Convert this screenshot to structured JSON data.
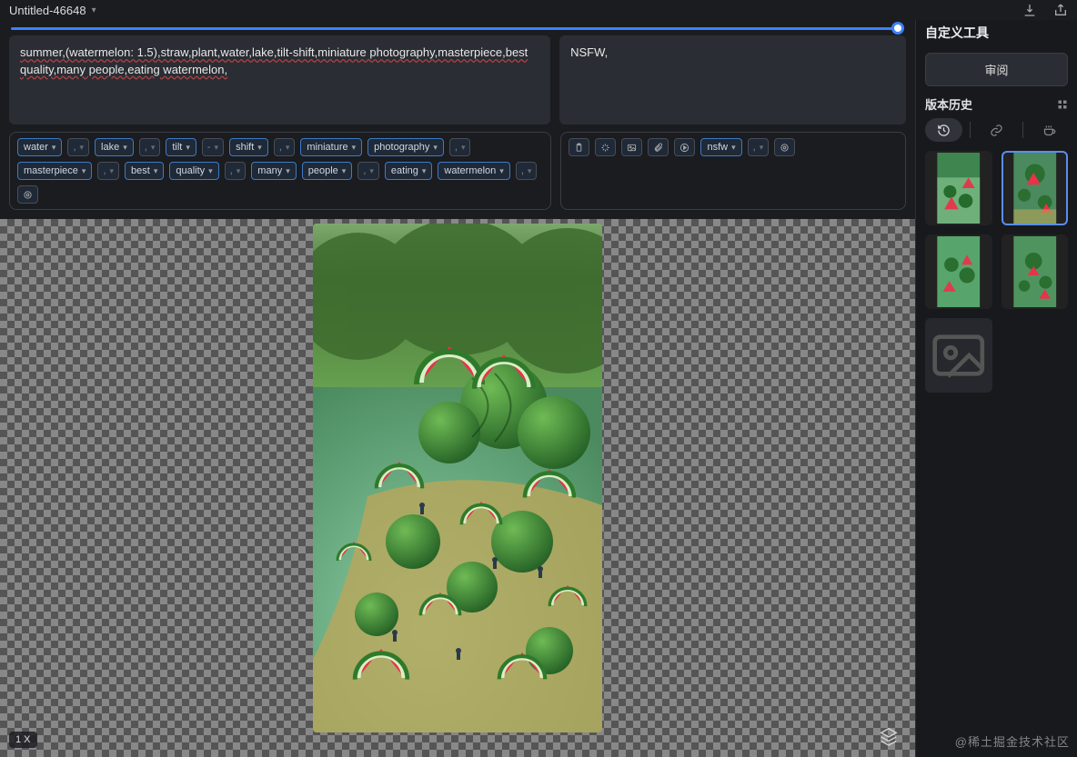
{
  "header": {
    "title": "Untitled-46648",
    "icons": [
      "download-icon",
      "share-icon"
    ]
  },
  "prompt": {
    "positive": "summer,(watermelon: 1.5),straw,plant,water,lake,tilt-shift,miniature photography,masterpiece,best quality,many people,eating watermelon,",
    "negative": "NSFW,"
  },
  "tags_positive_visible": [
    "water",
    ",",
    "lake",
    ",",
    "tilt",
    "-",
    "shift",
    ",",
    "miniature",
    "photography",
    ",",
    "masterpiece",
    ",",
    "best",
    "quality",
    ",",
    "many",
    "people",
    ",",
    "eating",
    "watermelon",
    ","
  ],
  "tags_positive_extra_icon": "target-icon",
  "tags_negative": [
    {
      "type": "icon",
      "name": "clipboard-icon"
    },
    {
      "type": "icon",
      "name": "sparkle-icon"
    },
    {
      "type": "icon",
      "name": "image-icon"
    },
    {
      "type": "icon",
      "name": "attach-icon"
    },
    {
      "type": "icon",
      "name": "play-icon"
    },
    {
      "type": "tag",
      "label": "nsfw"
    },
    {
      "type": "sep",
      "label": ","
    },
    {
      "type": "icon",
      "name": "target-icon"
    }
  ],
  "canvas": {
    "zoom": "1 X"
  },
  "right": {
    "title": "自定义工具",
    "review_btn": "审阅",
    "version_title": "版本历史",
    "tabs": [
      "history-icon",
      "link-icon",
      "coffee-icon"
    ],
    "active_tab": 0
  },
  "watermark": "@稀土掘金技术社区"
}
